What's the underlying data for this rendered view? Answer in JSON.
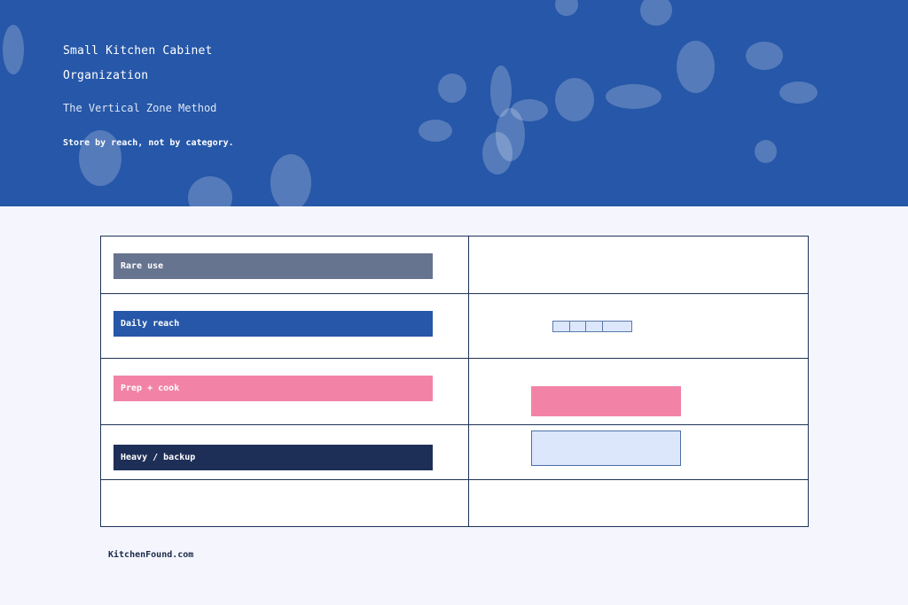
{
  "hero": {
    "title_line1": "Small Kitchen Cabinet",
    "title_line2": "Organization",
    "subtitle": "The Vertical Zone Method",
    "tagline": "Store by reach, not by category.",
    "background_color": "#2657a8"
  },
  "zones": [
    {
      "label": "Rare use",
      "color": "#67748f"
    },
    {
      "label": "Daily reach",
      "color": "#2657a8"
    },
    {
      "label": "Prep + cook",
      "color": "#f283a7"
    },
    {
      "label": "Heavy / backup",
      "color": "#1e2f57"
    }
  ],
  "footer": {
    "site": "KitchenFound.com"
  }
}
